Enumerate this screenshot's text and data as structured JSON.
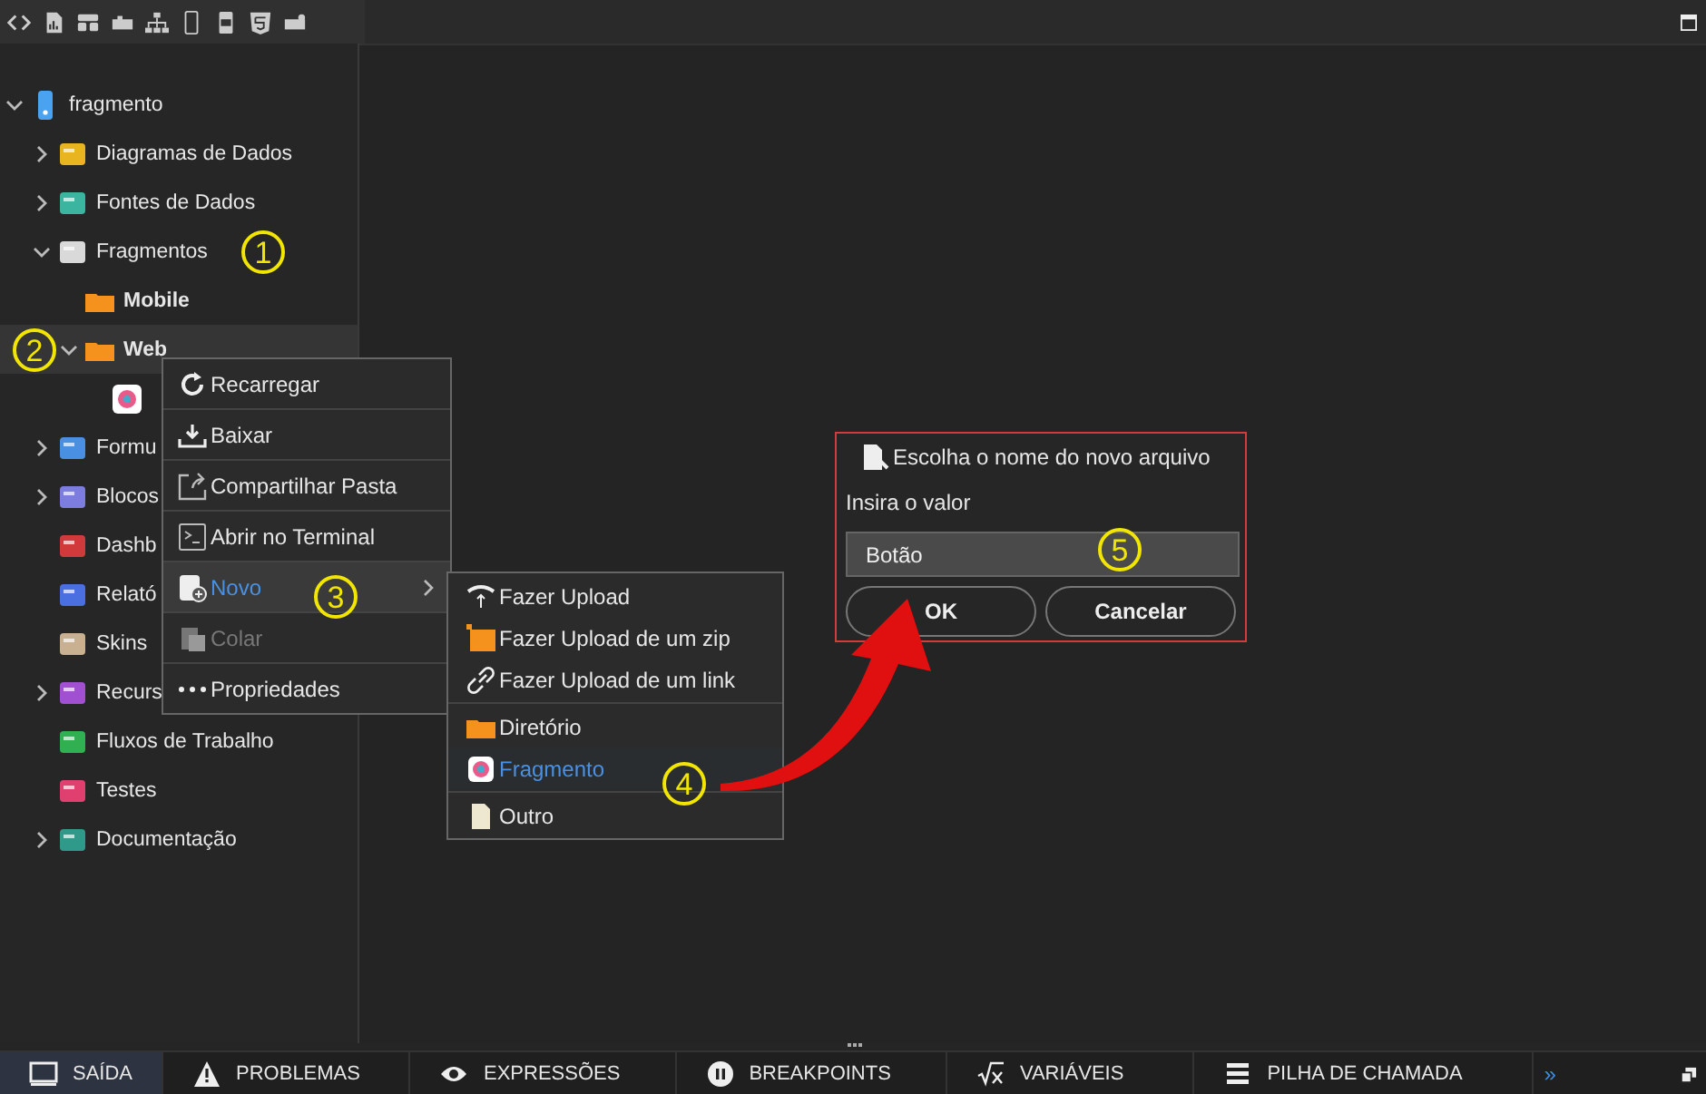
{
  "tree": [
    {
      "label": "fragmento",
      "kind": "device",
      "expandable": true,
      "expanded": true,
      "selected": false,
      "children": [
        {
          "label": "Diagramas de Dados",
          "kind": "diagram",
          "expandable": true,
          "expanded": false,
          "selected": false
        },
        {
          "label": "Fontes de Dados",
          "kind": "datasource",
          "expandable": true,
          "expanded": false,
          "selected": false
        },
        {
          "label": "Fragmentos",
          "kind": "fragments",
          "expandable": true,
          "expanded": true,
          "selected": false,
          "children": [
            {
              "label": "Mobile",
              "kind": "folder",
              "expandable": false,
              "selected": false
            },
            {
              "label": "Web",
              "kind": "folder",
              "expandable": true,
              "expanded": true,
              "selected": true,
              "children": [
                {
                  "kind": "fragment",
                  "expandable": false,
                  "selected": false
                }
              ]
            }
          ]
        },
        {
          "label": "Formu",
          "kind": "form",
          "expandable": true,
          "expanded": false,
          "selected": false
        },
        {
          "label": "Blocos",
          "kind": "block",
          "expandable": true,
          "expanded": false,
          "selected": false
        },
        {
          "label": "Dashb",
          "kind": "dashboard",
          "expandable": false,
          "selected": false
        },
        {
          "label": "Relató",
          "kind": "report",
          "expandable": false,
          "selected": false
        },
        {
          "label": "Skins",
          "kind": "skin",
          "expandable": false,
          "selected": false
        },
        {
          "label": "Recurs",
          "kind": "resource",
          "expandable": true,
          "expanded": false,
          "selected": false
        },
        {
          "label": "Fluxos de Trabalho",
          "kind": "workflow",
          "expandable": false,
          "selected": false
        },
        {
          "label": "Testes",
          "kind": "test",
          "expandable": false,
          "selected": false
        },
        {
          "label": "Documentação",
          "kind": "doc",
          "expandable": true,
          "expanded": false,
          "selected": false
        }
      ]
    }
  ],
  "context_menu": [
    {
      "label": "Recarregar",
      "kind": "reload",
      "disabled": false,
      "selected": false,
      "submenu": false
    },
    {
      "label": "Baixar",
      "kind": "download",
      "disabled": false,
      "selected": false,
      "submenu": false
    },
    {
      "label": "Compartilhar Pasta",
      "kind": "share",
      "disabled": false,
      "selected": false,
      "submenu": false
    },
    {
      "label": "Abrir no Terminal",
      "kind": "terminal",
      "disabled": false,
      "selected": false,
      "submenu": false
    },
    {
      "label": "Novo",
      "kind": "new",
      "disabled": false,
      "selected": true,
      "submenu": true
    },
    {
      "label": "Colar",
      "kind": "paste",
      "disabled": true,
      "selected": false,
      "submenu": false
    },
    {
      "label": "Propriedades",
      "kind": "dots",
      "disabled": false,
      "selected": false,
      "submenu": false
    }
  ],
  "submenu": [
    [
      {
        "label": "Fazer Upload",
        "kind": "upload",
        "selected": false
      },
      {
        "label": "Fazer Upload de um zip",
        "kind": "zip",
        "selected": false
      },
      {
        "label": "Fazer Upload de um link",
        "kind": "link",
        "selected": false
      }
    ],
    [
      {
        "label": "Diretório",
        "kind": "folder",
        "selected": false
      },
      {
        "label": "Fragmento",
        "kind": "fragment",
        "selected": true
      }
    ],
    [
      {
        "label": "Outro",
        "kind": "file",
        "selected": false
      }
    ]
  ],
  "dialog": {
    "title": "Escolha o nome do novo arquivo",
    "label": "Insira o valor",
    "value": "Botão",
    "buttons": [
      "OK",
      "Cancelar"
    ]
  },
  "callouts": [
    "1",
    "2",
    "3",
    "4",
    "5"
  ],
  "bottom_tabs": [
    {
      "label": "SAÍDA",
      "kind": "output",
      "selected": true
    },
    {
      "label": "PROBLEMAS",
      "kind": "warning",
      "selected": false
    },
    {
      "label": "EXPRESSÕES",
      "kind": "eye",
      "selected": false
    },
    {
      "label": "BREAKPOINTS",
      "kind": "pause",
      "selected": false
    },
    {
      "label": "VARIÁVEIS",
      "kind": "sqrt",
      "selected": false
    },
    {
      "label": "PILHA DE CHAMADA",
      "kind": "stack",
      "selected": false
    }
  ],
  "more": "»"
}
